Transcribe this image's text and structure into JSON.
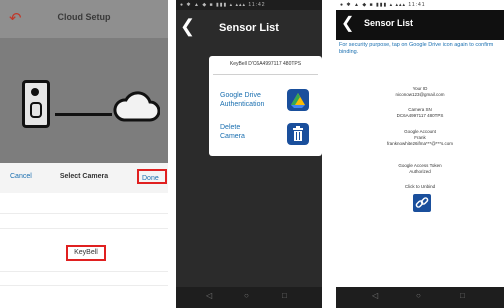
{
  "screen1": {
    "back_glyph": "↶",
    "title": "Cloud Setup",
    "cancel": "Cancel",
    "select_label": "Select Camera",
    "done": "Done",
    "picker_value": "KeyBell"
  },
  "screen2": {
    "status": "● ✱ ▲ ◆ ■ ▮▮▮ ▴ ▴▴▴ 11:42",
    "back_glyph": "❮",
    "title": "Sensor List",
    "device_id": "KeyBell D'C6A4997117 480TPS",
    "gdrive_label": "Google Drive Authentication",
    "delete_label": "Delete Camera",
    "nav": [
      "◁",
      "○",
      "□"
    ]
  },
  "screen3": {
    "status": "● ✱ ▲ ◆ ■ ▮▮▮ ▴ ▴▴▴ 11:41",
    "back_glyph": "❮",
    "title": "Sensor List",
    "note": "For security purpose, tap on Google Drive icon again to confirm binding.",
    "email_label": "Your ID",
    "email_value": "niconow123@gmail.com",
    "camera_label": "Camera SN",
    "camera_value": "DC6A4997117 480TPS",
    "account_label": "Google Account",
    "account_name": "Frank",
    "account_value": "franknowhite26ifma***@***s.com",
    "token_label": "Google Access Token",
    "token_value": "Authorized",
    "unbind_label": "Click to Unbind",
    "nav": [
      "◁",
      "○",
      "□"
    ]
  },
  "colors": {
    "accent": "#1a6fb0",
    "highlight_border": "#e02020",
    "icon_bg": "#1a4f9c"
  }
}
